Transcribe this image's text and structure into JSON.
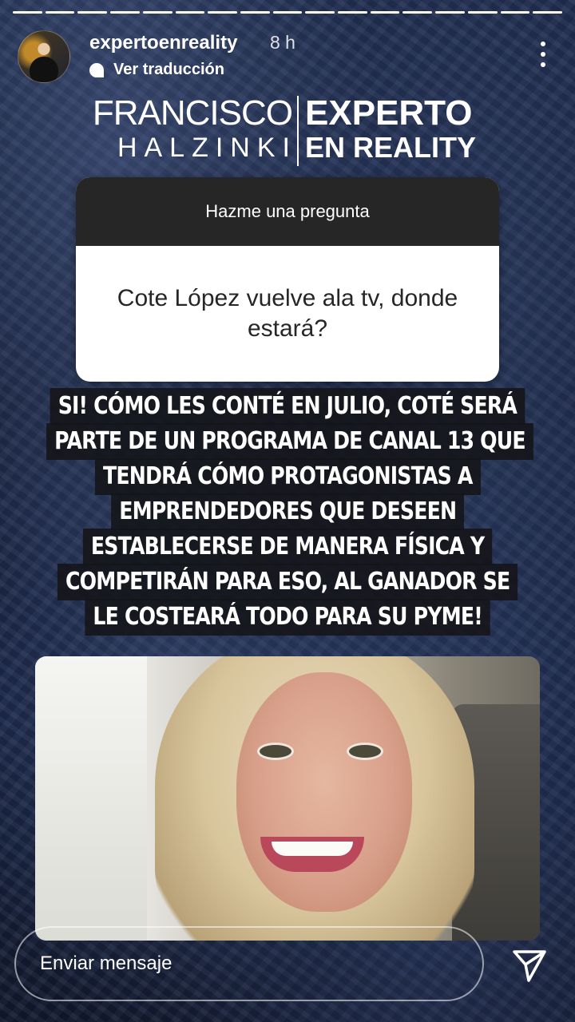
{
  "story": {
    "progress_segments": 17,
    "progress_current": 17
  },
  "header": {
    "username": "expertoenreality",
    "time": "8 h",
    "translate_label": "Ver traducción"
  },
  "logo": {
    "name_line1": "FRANCISCO",
    "name_line2": "HALZINKI",
    "brand_line1": "EXPERTO",
    "brand_line2": "EN REALITY"
  },
  "question": {
    "header": "Hazme una pregunta",
    "text": "Cote López vuelve ala tv, donde estará?"
  },
  "answer_lines": [
    "SI! CÓMO LES CONTÉ EN JULIO, COTÉ SERÁ",
    "PARTE DE UN PROGRAMA DE CANAL 13 QUE",
    "TENDRÁ CÓMO PROTAGONISTAS A",
    "EMPRENDEDORES QUE DESEEN",
    "ESTABLECERSE DE MANERA FÍSICA Y",
    "COMPETIRÁN PARA ESO, AL GANADOR SE",
    "LE COSTEARÁ TODO PARA SU PYME!"
  ],
  "footer": {
    "message_placeholder": "Enviar mensaje"
  },
  "icons": {
    "more": "more-vertical-icon",
    "translate": "speech-bubble-icon",
    "send": "paper-plane-icon"
  }
}
